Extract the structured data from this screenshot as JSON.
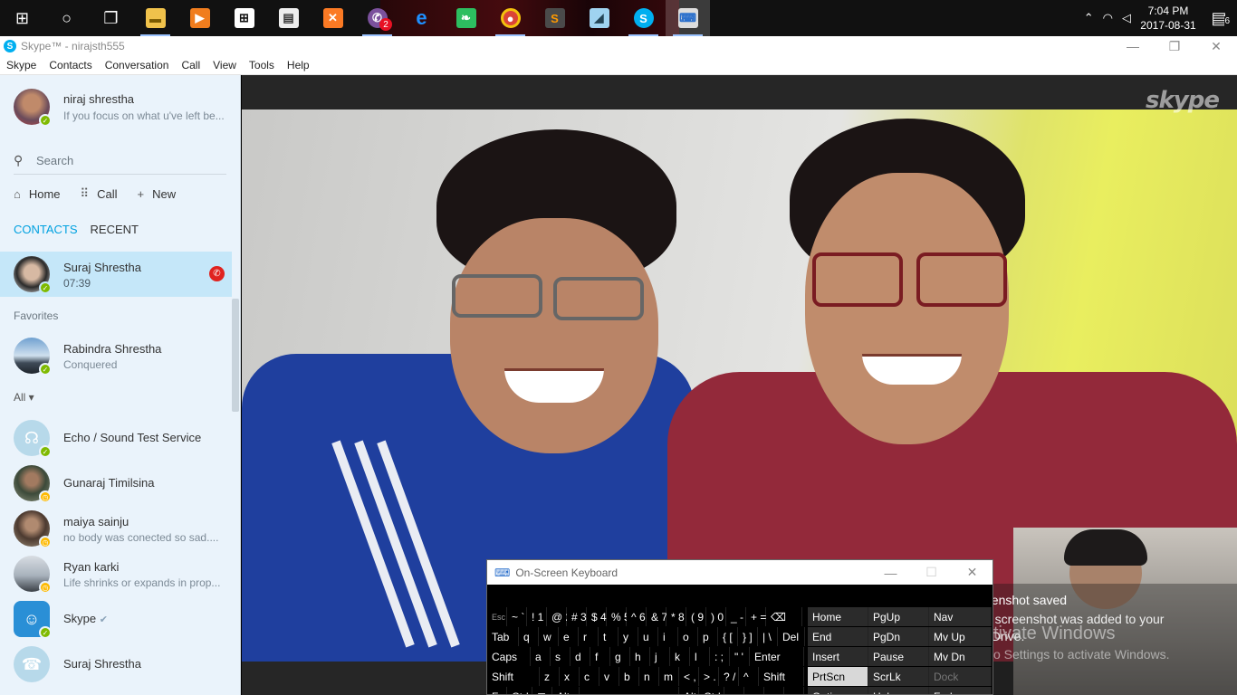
{
  "taskbar": {
    "apps": [
      {
        "icon": "start-icon"
      },
      {
        "icon": "cortana-icon"
      },
      {
        "icon": "task-view-icon"
      },
      {
        "icon": "file-explorer-icon"
      },
      {
        "icon": "media-player-icon"
      },
      {
        "icon": "store-icon"
      },
      {
        "icon": "document-icon"
      },
      {
        "icon": "xampp-icon"
      },
      {
        "icon": "viber-icon",
        "badge": "2"
      },
      {
        "icon": "edge-icon"
      },
      {
        "icon": "evernote-icon"
      },
      {
        "icon": "chrome-icon"
      },
      {
        "icon": "sublime-icon"
      },
      {
        "icon": "notepad-icon"
      },
      {
        "icon": "skype-icon"
      },
      {
        "icon": "on-screen-keyboard-icon"
      }
    ],
    "clock": {
      "time": "7:04 PM",
      "date": "2017-08-31"
    },
    "notification_count": "6"
  },
  "window": {
    "title": "Skype™ - nirajsth555",
    "menu": [
      "Skype",
      "Contacts",
      "Conversation",
      "Call",
      "View",
      "Tools",
      "Help"
    ]
  },
  "sidebar": {
    "me": {
      "name": "niraj shrestha",
      "mood": "If you focus on what u've left be..."
    },
    "search_placeholder": "Search",
    "nav": {
      "home": "Home",
      "call": "Call",
      "new": "New"
    },
    "tabs": {
      "contacts": "CONTACTS",
      "recent": "RECENT"
    },
    "active_call": {
      "name": "Suraj Shrestha",
      "duration": "07:39"
    },
    "favorites_label": "Favorites",
    "favorites": [
      {
        "name": "Rabindra Shrestha",
        "mood": "Conquered"
      }
    ],
    "all_label": "All",
    "contacts": [
      {
        "name": "Echo / Sound Test Service",
        "mood": ""
      },
      {
        "name": "Gunaraj Timilsina",
        "mood": ""
      },
      {
        "name": "maiya  sainju",
        "mood": "no body was conected so sad...."
      },
      {
        "name": "Ryan  karki",
        "mood": "Life shrinks or expands in prop..."
      },
      {
        "name": "Skype",
        "mood": ""
      },
      {
        "name": "Suraj Shrestha",
        "mood": ""
      }
    ]
  },
  "video": {
    "watermark": "skype"
  },
  "toast": {
    "title": "eenshot saved",
    "line1": "e screenshot was added to your",
    "line2": "eDrive."
  },
  "activation": {
    "line1": "tivate Windows",
    "line2": "o Settings to activate Windows."
  },
  "osk": {
    "title": "On-Screen Keyboard",
    "rows": [
      [
        "Esc",
        "~ `",
        "! 1",
        "@ 2",
        "# 3",
        "$ 4",
        "% 5",
        "^ 6",
        "& 7",
        "* 8",
        "( 9",
        ") 0",
        "_ -",
        "+ =",
        "⌫"
      ],
      [
        "Tab",
        "q",
        "w",
        "e",
        "r",
        "t",
        "y",
        "u",
        "i",
        "o",
        "p",
        "{ [",
        "} ]",
        "| \\",
        "Del"
      ],
      [
        "Caps",
        "a",
        "s",
        "d",
        "f",
        "g",
        "h",
        "j",
        "k",
        "l",
        ": ;",
        "\" '",
        "Enter"
      ],
      [
        "Shift",
        "z",
        "x",
        "c",
        "v",
        "b",
        "n",
        "m",
        "< ,",
        "> .",
        "? /",
        "^",
        "Shift"
      ],
      [
        "Fn",
        "Ctrl",
        "⊞",
        "Alt",
        "",
        "Alt",
        "Ctrl",
        "<",
        "v",
        ">",
        "≡"
      ]
    ],
    "nav_keys": [
      [
        "Home",
        "PgUp",
        "Nav"
      ],
      [
        "End",
        "PgDn",
        "Mv Up"
      ],
      [
        "Insert",
        "Pause",
        "Mv Dn"
      ],
      [
        "PrtScn",
        "ScrLk",
        "Dock"
      ],
      [
        "Options",
        "Help",
        "Fade"
      ]
    ]
  }
}
